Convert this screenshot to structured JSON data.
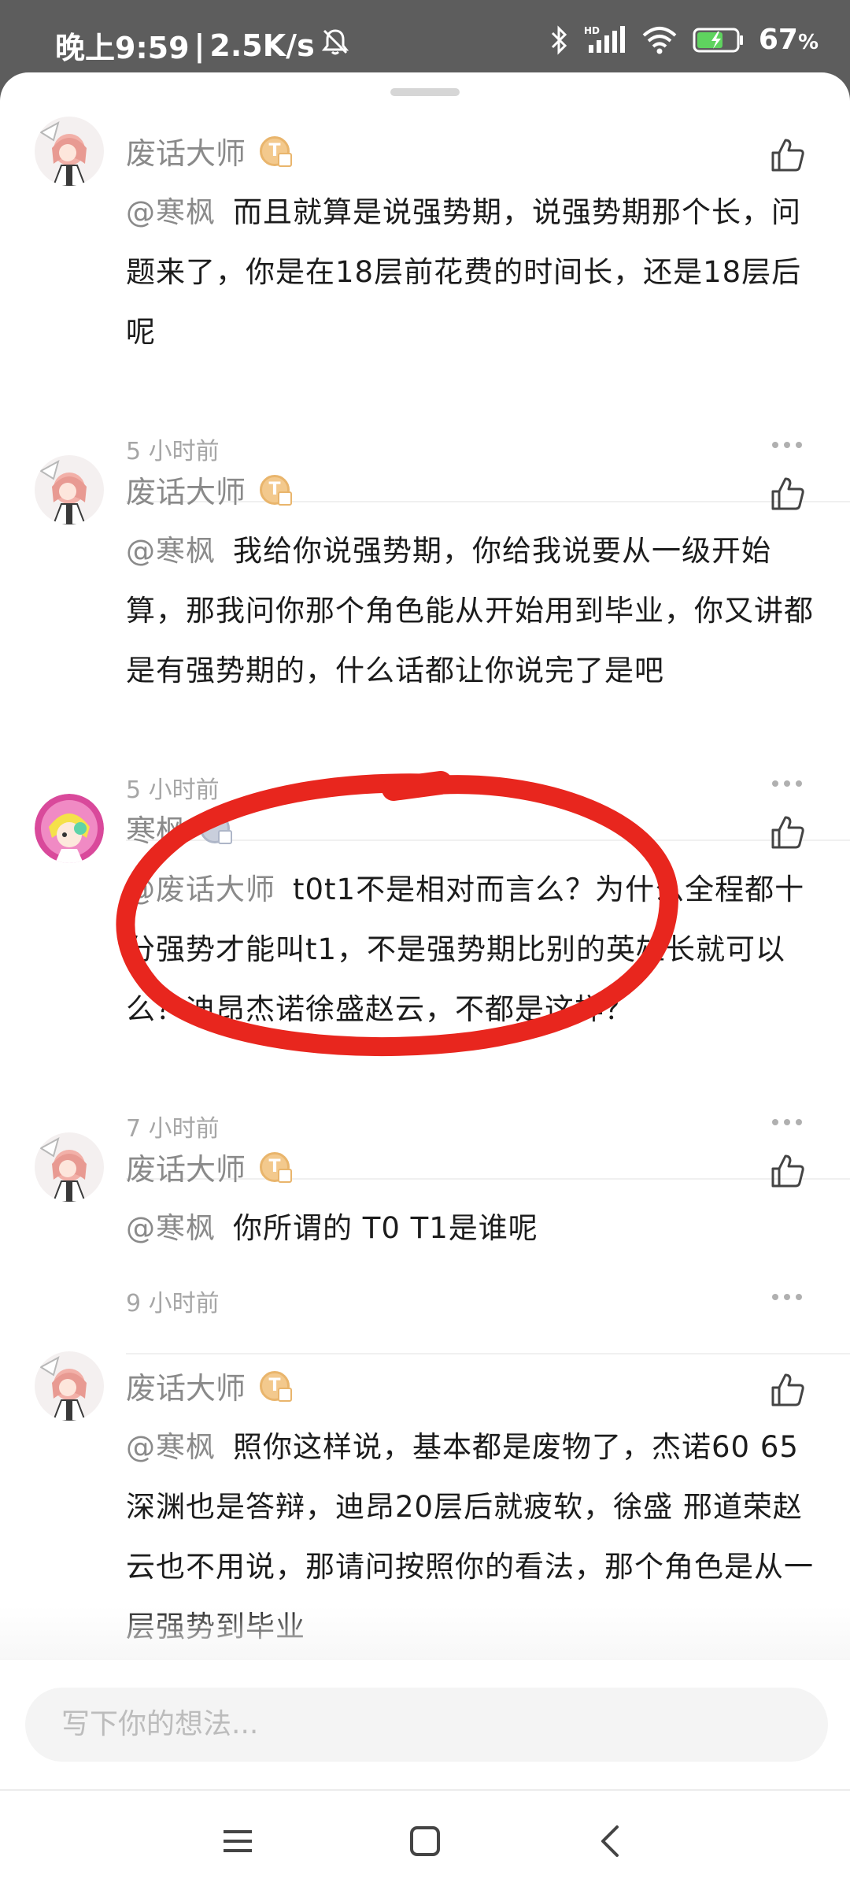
{
  "status_bar": {
    "time": "晚上9:59",
    "separator": "|",
    "net_speed": "2.5K/s",
    "battery": "67",
    "battery_unit": "%",
    "icons": [
      "mute-bell-icon",
      "bluetooth-icon",
      "hd-signal-icon",
      "wifi-icon",
      "battery-charging-icon"
    ]
  },
  "comments": [
    {
      "username": "废话大师",
      "badge": "T",
      "mention": "@寒枫",
      "text": "而且就算是说强势期，说强势期那个长，问题来了，你是在18层前花费的时间长，还是18层后呢",
      "time": "5 小时前"
    },
    {
      "username": "废话大师",
      "badge": "T",
      "mention": "@寒枫",
      "text": "我给你说强势期，你给我说要从一级开始算，那我问你那个角色能从开始用到毕业，你又讲都是有强势期的，什么话都让你说完了是吧",
      "time": "5 小时前"
    },
    {
      "username": "寒枫",
      "badge": "",
      "mention": "@废话大师",
      "text": "t0t1不是相对而言么？为什么全程都十分强势才能叫t1，不是强势期比别的英雄长就可以么？迪昂杰诺徐盛赵云，不都是这样？",
      "time": "7 小时前"
    },
    {
      "username": "废话大师",
      "badge": "T",
      "mention": "@寒枫",
      "text": "你所谓的 T0 T1是谁呢",
      "time": "9 小时前"
    },
    {
      "username": "废话大师",
      "badge": "T",
      "mention": "@寒枫",
      "text": "照你这样说，基本都是废物了，杰诺60 65深渊也是答辩，迪昂20层后就疲软，徐盛 邢道荣赵云也不用说，那请问按照你的看法，那个角色是从一层强势到毕业",
      "time": ""
    }
  ],
  "composer": {
    "placeholder": "写下你的想法..."
  },
  "nav_bar": {
    "icons": [
      "menu-icon",
      "home-icon",
      "back-icon"
    ]
  },
  "colors": {
    "annotation_red": "#e8261e",
    "username_grey": "#8a8a8a",
    "badge_gold": "#f3c98d"
  }
}
